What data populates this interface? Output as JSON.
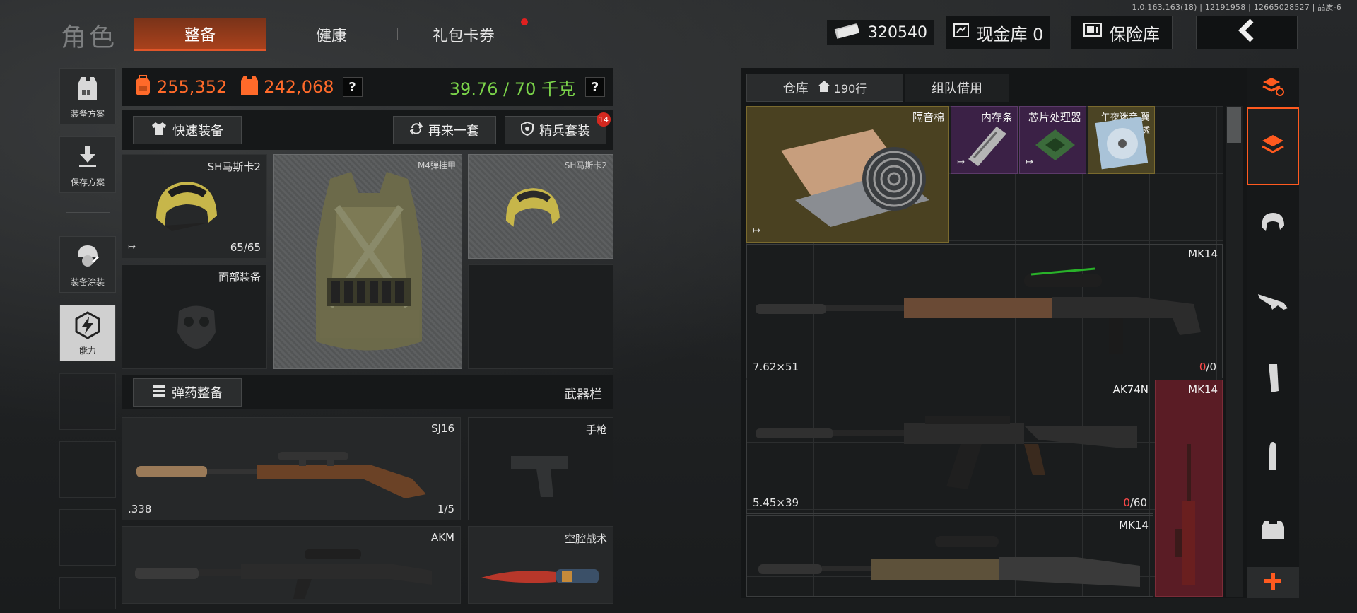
{
  "version": "1.0.163.163(18) | 12191958 | 12665028527 | 品质-6",
  "header": {
    "title": "角色",
    "tabs": [
      {
        "label": "整备",
        "active": true
      },
      {
        "label": "健康",
        "active": false
      },
      {
        "label": "礼包卡券",
        "active": false,
        "dot": true
      }
    ],
    "cash_amount": "320540",
    "cash_vault_label": "现金库 0",
    "safe_label": "保险库",
    "back_icon": "chevron-left-icon"
  },
  "sidebar": [
    {
      "label": "装备方案",
      "icon": "vest-icon"
    },
    {
      "label": "保存方案",
      "icon": "download-icon"
    },
    {
      "label": "装备涂装",
      "icon": "helmet-paint-icon"
    },
    {
      "label": "能力",
      "icon": "lightning-icon",
      "active": true
    }
  ],
  "stats": {
    "value1": "255,352",
    "value2": "242,068",
    "weight": "39.76 / 70 千克",
    "help": "?",
    "colors": {
      "orange": "#ff6a2a",
      "green": "#7bd34a"
    }
  },
  "loadout": {
    "quick_equip": "快速装备",
    "redo": "再来一套",
    "elite": "精兵套装",
    "elite_badge": "14",
    "ammo_equip": "弹药整备",
    "weapon_bar": "武器栏",
    "slots": {
      "helmet": {
        "name": "SH马斯卡2",
        "durability": "65/65"
      },
      "armor": {
        "name": "M4弹挂甲"
      },
      "helmet_alt": {
        "name": "SH马斯卡2"
      },
      "face": {
        "name": "面部装备"
      },
      "primary": {
        "name": "SJ16",
        "caliber": ".338",
        "ammo": "1/5"
      },
      "pistol": {
        "name": "手枪"
      },
      "secondary": {
        "name": "AKM"
      },
      "melee": {
        "name": "空腔战术"
      }
    }
  },
  "storage": {
    "tab_storage": "仓库",
    "rows": "190行",
    "tab_team": "组队借用",
    "items": [
      {
        "name": "隔音棉",
        "rarity": "gold"
      },
      {
        "name": "内存条",
        "rarity": "purple"
      },
      {
        "name": "芯片处理器",
        "rarity": "purple"
      },
      {
        "name": "午夜迷音 翼透",
        "rarity": "gold"
      },
      {
        "name": "MK14",
        "caliber": "7.62×51",
        "ammo_current": "0",
        "ammo_max": "/0"
      },
      {
        "name": "AK74N",
        "caliber": "5.45×39",
        "ammo_current": "0",
        "ammo_max": "/60"
      },
      {
        "name": "MK14",
        "rarity": "red"
      },
      {
        "name": "MK14"
      }
    ]
  },
  "categories": [
    "stack-refresh-icon",
    "stack-icon",
    "helmet-icon",
    "rifle-icon",
    "magazine-icon",
    "ammo-icon",
    "armor-icon",
    "plus-icon"
  ]
}
